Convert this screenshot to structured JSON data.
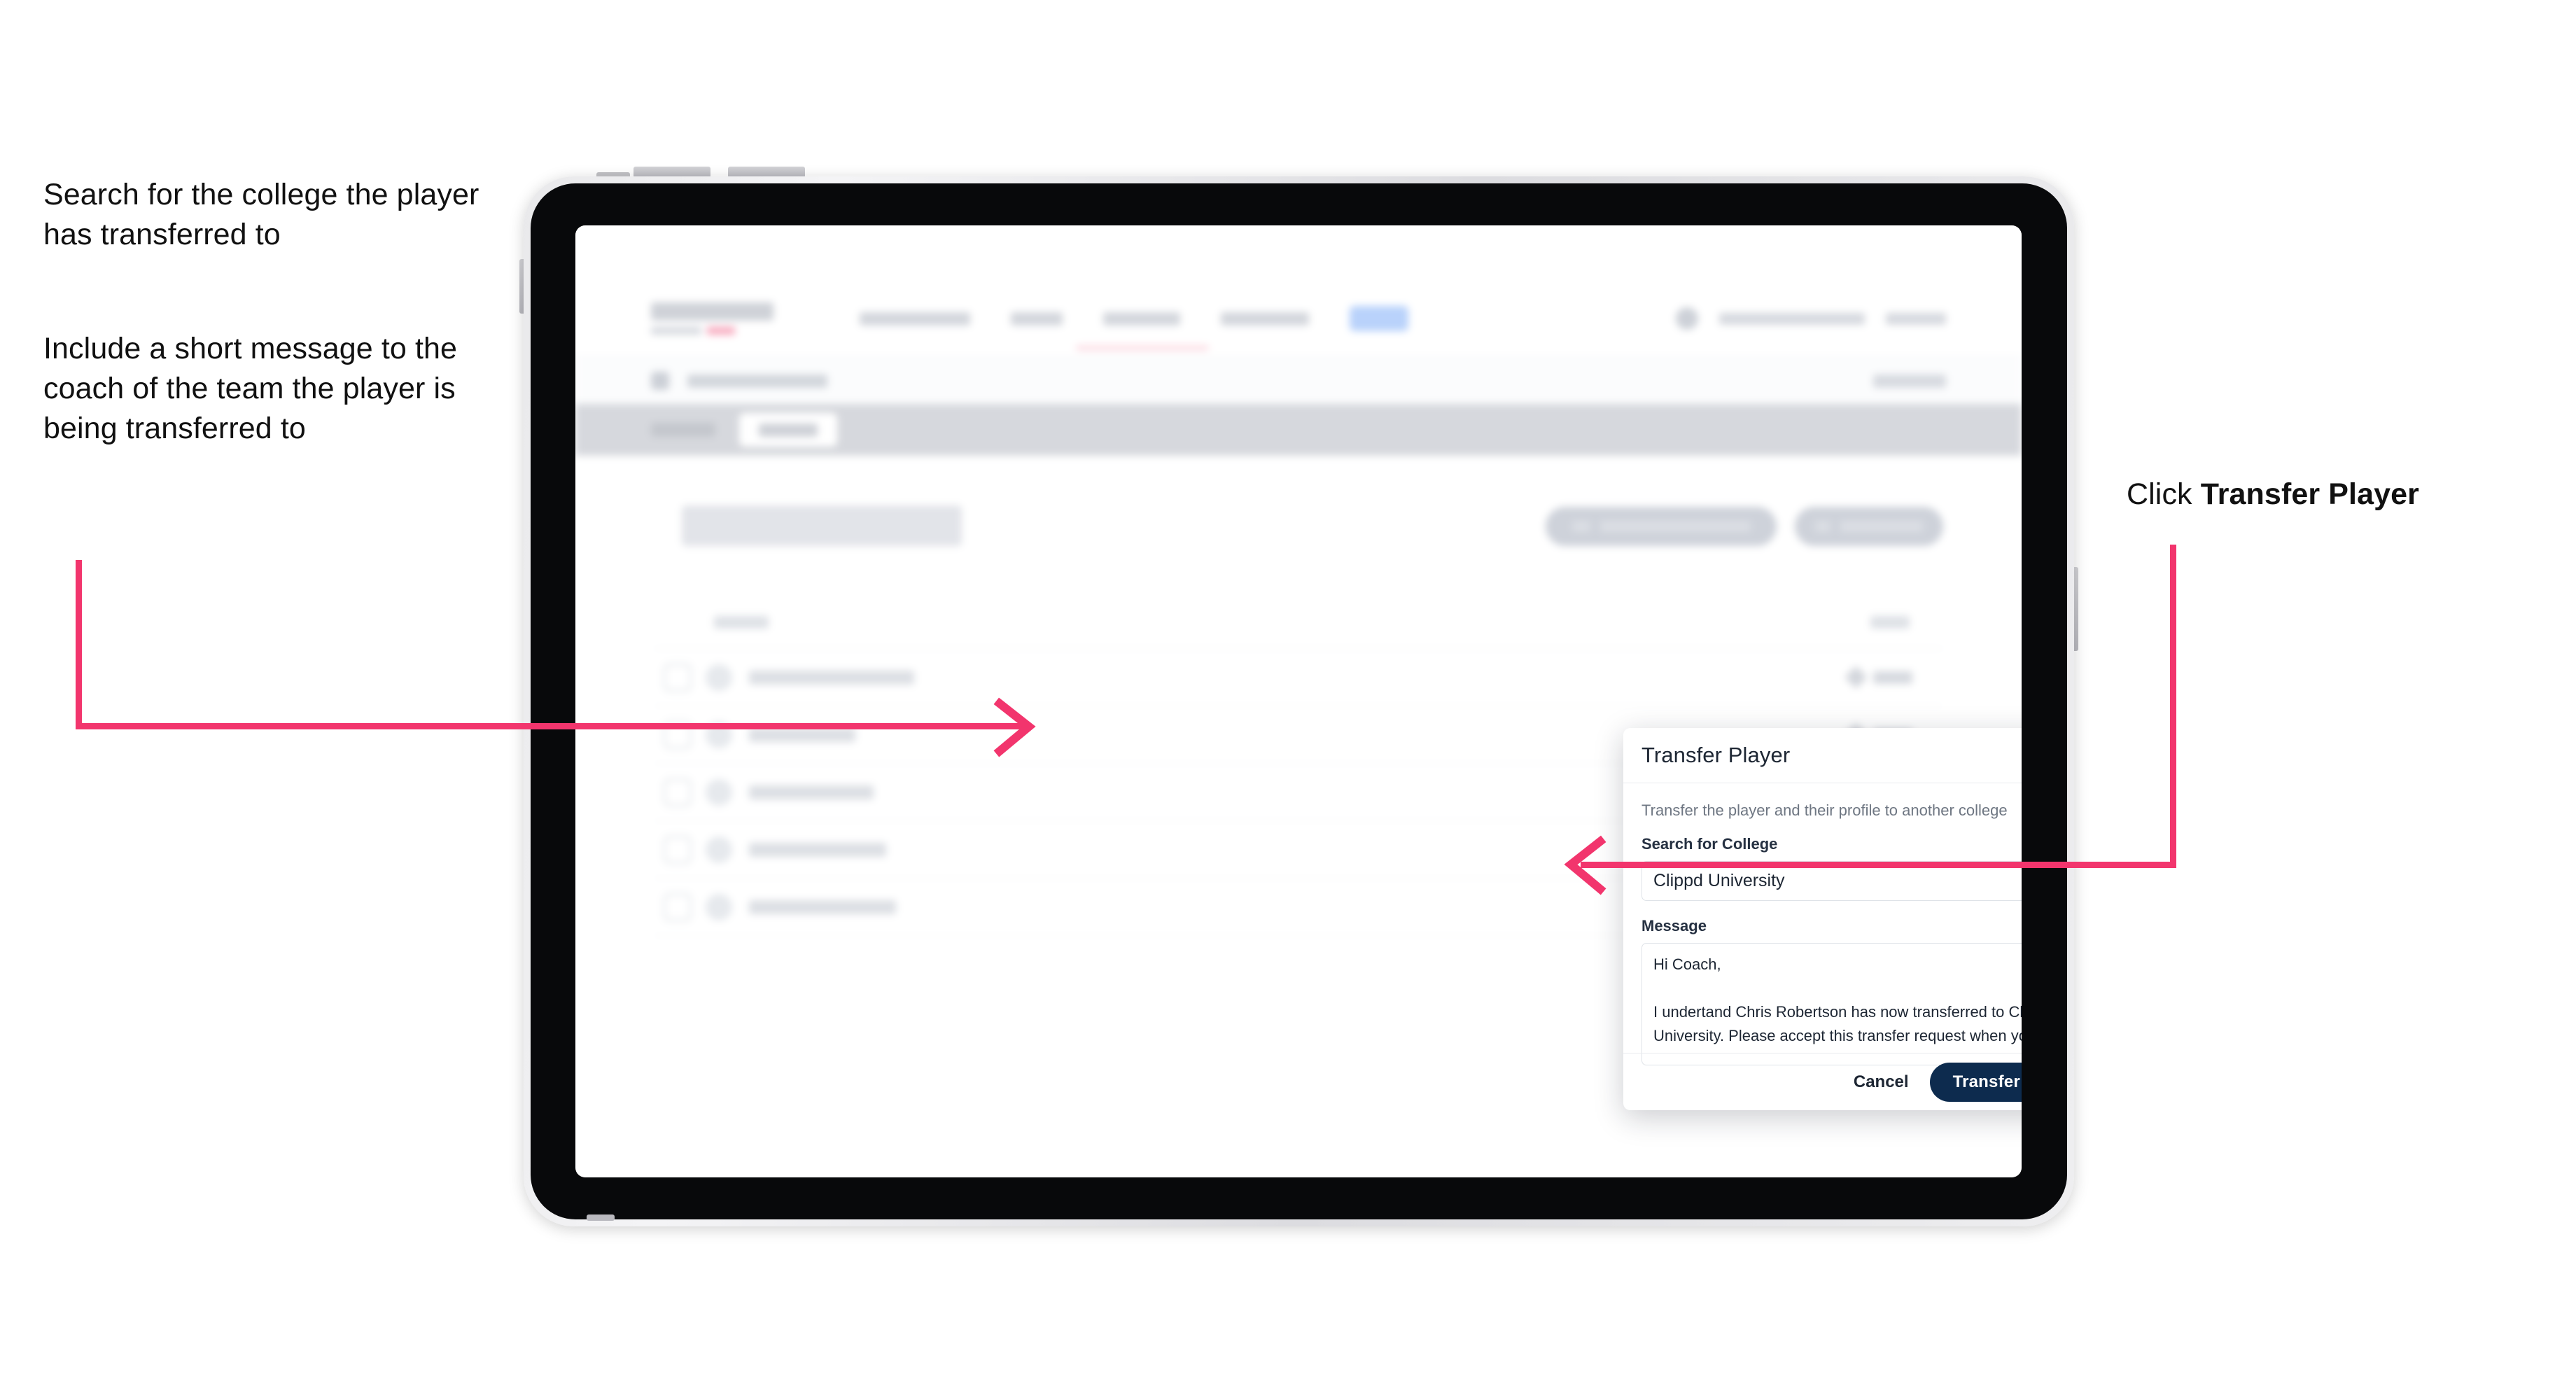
{
  "annotations": {
    "left_note_1": "Search for the college the player has transferred to",
    "left_note_2": "Include a short message to the coach of the team the player is being transferred to",
    "right_note_prefix": "Click ",
    "right_note_bold": "Transfer Player"
  },
  "modal": {
    "title": "Transfer Player",
    "close_icon": "close-icon",
    "description": "Transfer the player and their profile to another college",
    "college_label": "Search for College",
    "college_value": "Clippd University",
    "college_placeholder": "Search for College",
    "message_label": "Message",
    "message_value": "Hi Coach,\n\nI undertand Chris Robertson has now transferred to Clippd University. Please accept this transfer request when you can.",
    "message_placeholder": "Message",
    "cancel_label": "Cancel",
    "submit_label": "Transfer Player"
  },
  "colors": {
    "accent_pink": "#F2356D",
    "primary_navy": "#0D2B4E",
    "text_dark": "#1d2633",
    "muted": "#6e7682"
  }
}
